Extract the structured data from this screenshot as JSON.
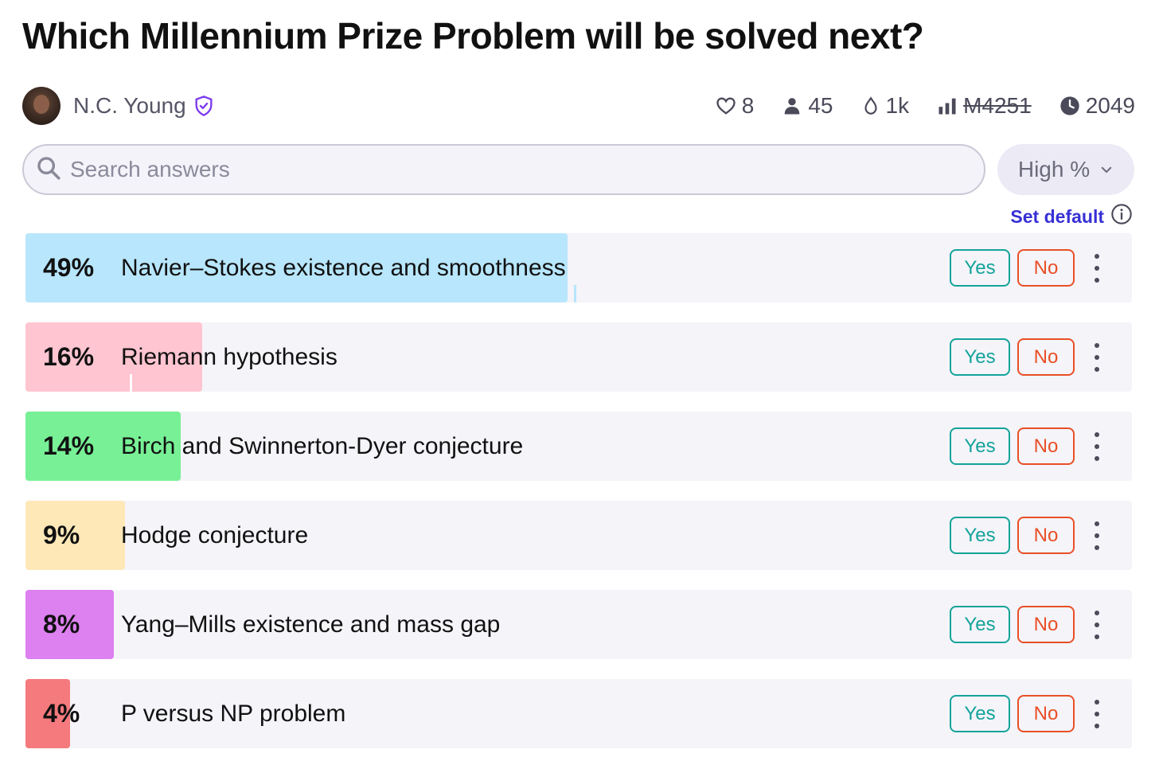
{
  "title": "Which Millennium Prize Problem will be solved next?",
  "author": {
    "name": "N.C. Young",
    "avatar_icon": "avatar",
    "verified_icon": "shield-check-icon"
  },
  "stats": {
    "likes": "8",
    "traders": "45",
    "liquidity": "1k",
    "volume": "M4251",
    "closes": "2049"
  },
  "search": {
    "placeholder": "Search answers"
  },
  "sort": {
    "label": "High %"
  },
  "set_default": {
    "label": "Set default"
  },
  "buttons": {
    "yes": "Yes",
    "no": "No"
  },
  "answers": [
    {
      "pct_label": "49%",
      "text": "Navier–Stokes existence and smoothness",
      "probability": 0.49,
      "color": "#b8e6fc"
    },
    {
      "pct_label": "16%",
      "text": "Riemann hypothesis",
      "probability": 0.16,
      "color": "#ffc5d0"
    },
    {
      "pct_label": "14%",
      "text": "Birch and Swinnerton-Dyer conjecture",
      "probability": 0.14,
      "color": "#78f096"
    },
    {
      "pct_label": "9%",
      "text": "Hodge conjecture",
      "probability": 0.09,
      "color": "#ffe8b8"
    },
    {
      "pct_label": "8%",
      "text": "Yang–Mills existence and mass gap",
      "probability": 0.08,
      "color": "#dd80f0"
    },
    {
      "pct_label": "4%",
      "text": "P versus NP problem",
      "probability": 0.04,
      "color": "#f57a7d"
    }
  ],
  "colors": {
    "yes": "#14a39a",
    "no": "#ea4f27",
    "link": "#3730d6"
  }
}
